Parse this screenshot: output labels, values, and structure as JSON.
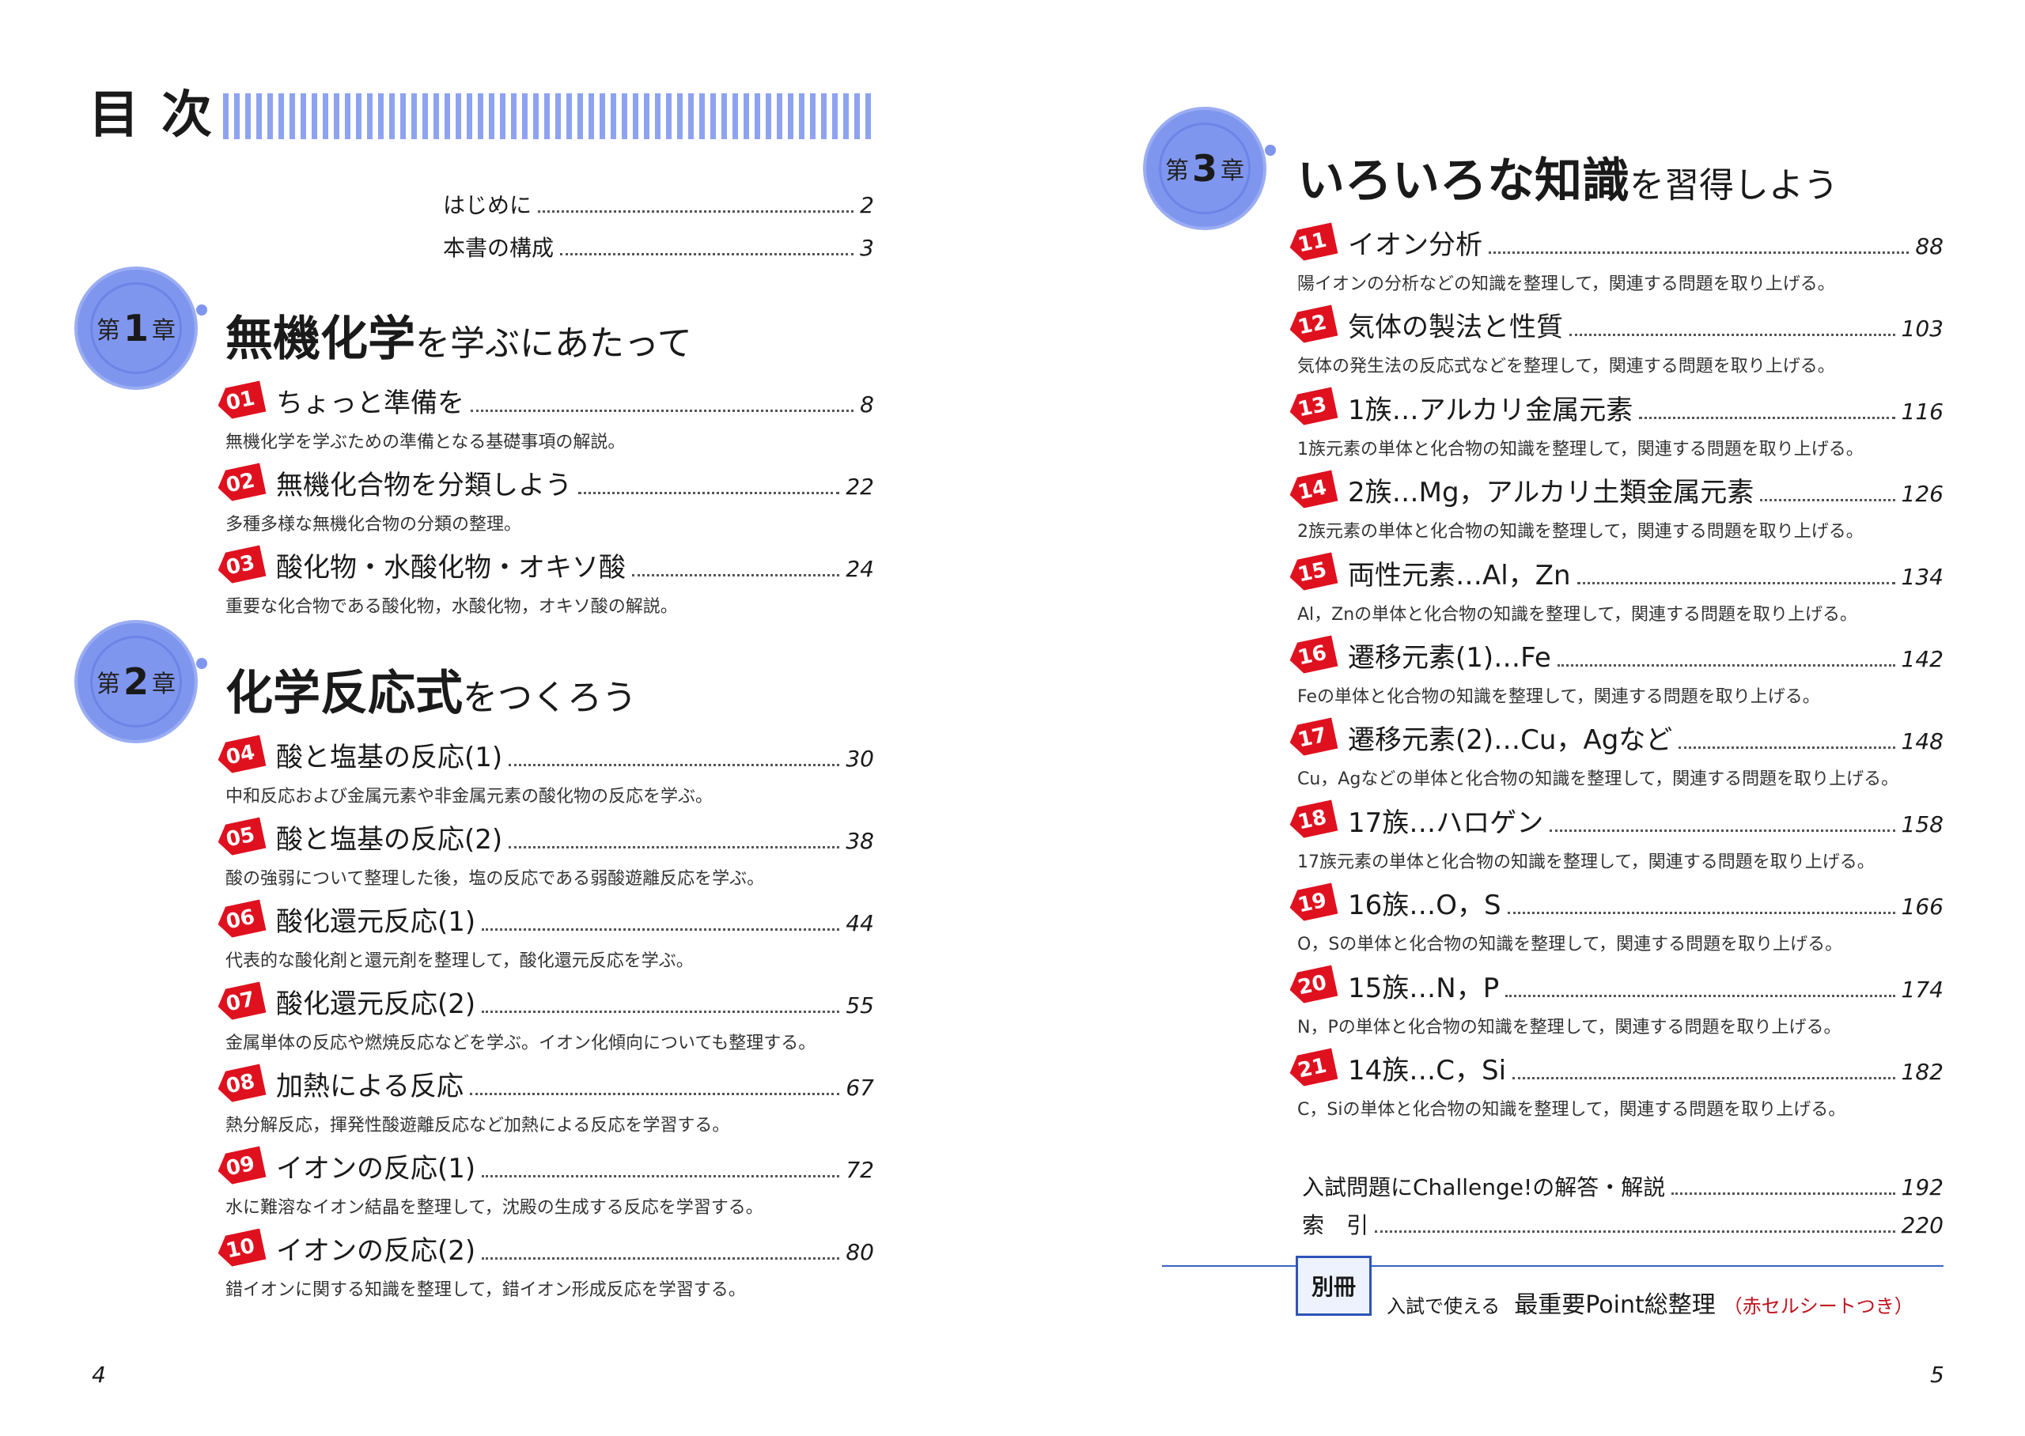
{
  "toc_title": "目次",
  "front_matter": [
    {
      "label": "はじめに",
      "page": "2"
    },
    {
      "label": "本書の構成",
      "page": "3"
    }
  ],
  "chapters": [
    {
      "prefix": "第",
      "num": "1",
      "suffix": "章",
      "title_bold": "無機化学",
      "title_rest": "を学ぶにあたって"
    },
    {
      "prefix": "第",
      "num": "2",
      "suffix": "章",
      "title_bold": "化学反応式",
      "title_rest": "をつくろう"
    },
    {
      "prefix": "第",
      "num": "3",
      "suffix": "章",
      "title_bold": "いろいろな知識",
      "title_rest": "を習得しよう"
    }
  ],
  "items": [
    {
      "num": "01",
      "title": "ちょっと準備を",
      "page": "8",
      "desc": "無機化学を学ぶための準備となる基礎事項の解説。"
    },
    {
      "num": "02",
      "title": "無機化合物を分類しよう",
      "page": "22",
      "desc": "多種多様な無機化合物の分類の整理。"
    },
    {
      "num": "03",
      "title": "酸化物・水酸化物・オキソ酸",
      "page": "24",
      "desc": "重要な化合物である酸化物，水酸化物，オキソ酸の解説。"
    },
    {
      "num": "04",
      "title": "酸と塩基の反応(1)",
      "page": "30",
      "desc": "中和反応および金属元素や非金属元素の酸化物の反応を学ぶ。"
    },
    {
      "num": "05",
      "title": "酸と塩基の反応(2)",
      "page": "38",
      "desc": "酸の強弱について整理した後，塩の反応である弱酸遊離反応を学ぶ。"
    },
    {
      "num": "06",
      "title": "酸化還元反応(1)",
      "page": "44",
      "desc": "代表的な酸化剤と還元剤を整理して，酸化還元反応を学ぶ。"
    },
    {
      "num": "07",
      "title": "酸化還元反応(2)",
      "page": "55",
      "desc": "金属単体の反応や燃焼反応などを学ぶ。イオン化傾向についても整理する。"
    },
    {
      "num": "08",
      "title": "加熱による反応",
      "page": "67",
      "desc": "熱分解反応，揮発性酸遊離反応など加熱による反応を学習する。"
    },
    {
      "num": "09",
      "title": "イオンの反応(1)",
      "page": "72",
      "desc": "水に難溶なイオン結晶を整理して，沈殿の生成する反応を学習する。"
    },
    {
      "num": "10",
      "title": "イオンの反応(2)",
      "page": "80",
      "desc": "錯イオンに関する知識を整理して，錯イオン形成反応を学習する。"
    },
    {
      "num": "11",
      "title": "イオン分析",
      "page": "88",
      "desc": "陽イオンの分析などの知識を整理して，関連する問題を取り上げる。"
    },
    {
      "num": "12",
      "title": "気体の製法と性質",
      "page": "103",
      "desc": "気体の発生法の反応式などを整理して，関連する問題を取り上げる。"
    },
    {
      "num": "13",
      "title": "1族…アルカリ金属元素",
      "page": "116",
      "desc": "1族元素の単体と化合物の知識を整理して，関連する問題を取り上げる。"
    },
    {
      "num": "14",
      "title": "2族…Mg，アルカリ土類金属元素",
      "page": "126",
      "desc": "2族元素の単体と化合物の知識を整理して，関連する問題を取り上げる。"
    },
    {
      "num": "15",
      "title": "両性元素…Al，Zn",
      "page": "134",
      "desc": "Al，Znの単体と化合物の知識を整理して，関連する問題を取り上げる。"
    },
    {
      "num": "16",
      "title": "遷移元素(1)…Fe",
      "page": "142",
      "desc": "Feの単体と化合物の知識を整理して，関連する問題を取り上げる。"
    },
    {
      "num": "17",
      "title": "遷移元素(2)…Cu，Agなど",
      "page": "148",
      "desc": "Cu，Agなどの単体と化合物の知識を整理して，関連する問題を取り上げる。"
    },
    {
      "num": "18",
      "title": "17族…ハロゲン",
      "page": "158",
      "desc": "17族元素の単体と化合物の知識を整理して，関連する問題を取り上げる。"
    },
    {
      "num": "19",
      "title": "16族…O，S",
      "page": "166",
      "desc": "O，Sの単体と化合物の知識を整理して，関連する問題を取り上げる。"
    },
    {
      "num": "20",
      "title": "15族…N，P",
      "page": "174",
      "desc": "N，Pの単体と化合物の知識を整理して，関連する問題を取り上げる。"
    },
    {
      "num": "21",
      "title": "14族…C，Si",
      "page": "182",
      "desc": "C，Siの単体と化合物の知識を整理して，関連する問題を取り上げる。"
    }
  ],
  "back_matter": [
    {
      "label": "入試問題にChallenge!の解答・解説",
      "page": "192"
    },
    {
      "label": "索　引",
      "page": "220"
    }
  ],
  "supplement": {
    "badge": "別冊",
    "lead": "入試で使える",
    "title": "最重要Point総整理",
    "note": "（赤セルシートつき）"
  },
  "page_numbers": {
    "left": "4",
    "right": "5"
  },
  "colors": {
    "accent_blue": "#7f96ef",
    "tag_red": "#e0111f",
    "note_red": "#c0121e"
  }
}
